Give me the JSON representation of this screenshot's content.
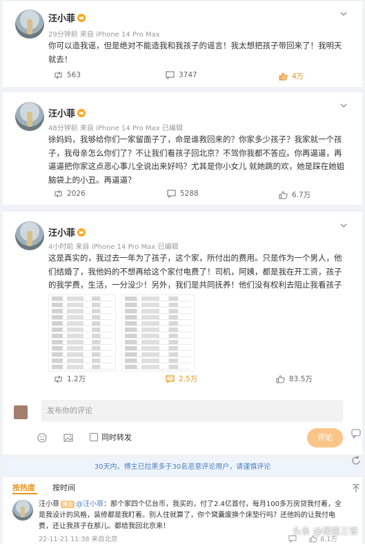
{
  "posts": [
    {
      "author": "汪小菲",
      "meta": "29分钟前 来自 iPhone 14 Pro Max",
      "text": "你可以造我谣，但是绝对不能造我和我孩子的谣言！我太想把孩子带回来了！我明天就去！",
      "repost_count": "563",
      "comment_count": "3747",
      "like_count": "4万"
    },
    {
      "author": "汪小菲",
      "meta": "48分钟前 来自 iPhone 14 Pro Max 已编辑",
      "text": "徐妈妈，我够给你们一家留面子了，命是谁救回来的？你家多少孩子？我家就一个孩子，我母亲怎么你们了？不让我们看孩子回北京？不驾你我都不答应。你再逼逼，再逼逼把你家这点恶心事儿全说出来好吗？尤其是你小女儿 就她跳的欢，她是踩在她姐脑袋上的小丑。再逼逼？",
      "repost_count": "2026",
      "comment_count": "5288",
      "like_count": "6.7万"
    },
    {
      "author": "汪小菲",
      "meta": "4小时前 来自 iPhone 14 Pro Max 已编辑",
      "text": "这是真实的，我过去一年为了孩子，这个家，所付出的费用。只是作为一个男人，他们结婚了，我他妈的不想再给这个家付电费了！司机，阿姨，都是我在开工资，孩子的我学费，生活，一分没少！另外，我们是共同抚养！他们没有权利去阻止我看孩子",
      "repost_count": "1.2万",
      "comment_count": "2.5万",
      "like_count": "83.5万"
    }
  ],
  "composer": {
    "placeholder": "发布你的评论",
    "repost_label": "同时转发",
    "submit_label": "评论"
  },
  "notice": "30天内，博主已拉黑多于30名恶意评论用户，请谨慎评论",
  "sort": {
    "hot": "按热度",
    "time": "按时间"
  },
  "top_comment": {
    "user": "汪小菲",
    "badge": "博主",
    "reply_to": "@汪小菲",
    "text": "：那个家四个亿台币，我买的，付了2.4亿首付，每月100多万房贷我付着，全是我设计的风格，装修都是我盯着。别人住就算了，你个窝囊废换个床垫行吗？还他妈的让我付电费，还让我孩子在那儿。都给我回北京来！",
    "meta": "22-11-21 11:38 来自北京",
    "like_count": "6.1万"
  },
  "watermark": "头条 @檬酱三餐",
  "colors": {
    "accent": "#e6951d",
    "link": "#4a7fc2",
    "button": "#fbc58a"
  }
}
